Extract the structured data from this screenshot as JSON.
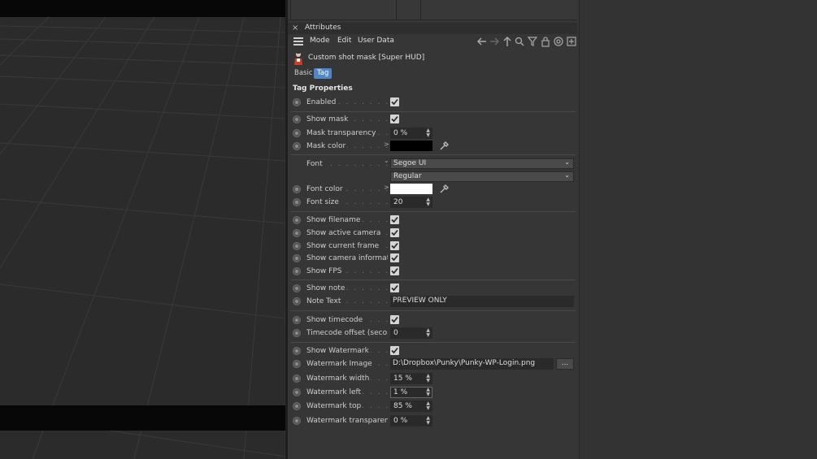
{
  "panel": {
    "title": "Attributes",
    "close_glyph": "×",
    "menu": [
      "Mode",
      "Edit",
      "User Data"
    ],
    "toolbar_icons": [
      "arrow-left-icon",
      "arrow-right-icon",
      "arrow-up-icon",
      "search-icon",
      "filter-icon",
      "lock-icon",
      "target-icon",
      "new-panel-icon"
    ]
  },
  "object": {
    "name": "Custom shot mask [Super HUD]",
    "icon": "person-icon"
  },
  "tabs": [
    {
      "label": "Basic",
      "active": false
    },
    {
      "label": "Tag",
      "active": true
    }
  ],
  "section_title": "Tag Properties",
  "fields": {
    "enabled": {
      "label": "Enabled",
      "checked": true
    },
    "show_mask": {
      "label": "Show mask",
      "checked": true
    },
    "mask_transparency": {
      "label": "Mask transparency",
      "value": "0 %"
    },
    "mask_color": {
      "label": "Mask color",
      "color": "#000000"
    },
    "font": {
      "label": "Font",
      "family": "Segoe UI",
      "style": "Regular"
    },
    "font_color": {
      "label": "Font color",
      "color": "#ffffff"
    },
    "font_size": {
      "label": "Font size",
      "value": "20"
    },
    "show_filename": {
      "label": "Show filename",
      "checked": true
    },
    "show_active_camera": {
      "label": "Show active camera",
      "checked": true
    },
    "show_current_frame": {
      "label": "Show current frame",
      "checked": true
    },
    "show_camera_information": {
      "label": "Show camera information",
      "checked": true
    },
    "show_fps": {
      "label": "Show FPS",
      "checked": true
    },
    "show_note": {
      "label": "Show note",
      "checked": true
    },
    "note_text": {
      "label": "Note Text",
      "value": "PREVIEW ONLY"
    },
    "show_timecode": {
      "label": "Show timecode",
      "checked": true
    },
    "timecode_offset": {
      "label": "Timecode offset (seconds)",
      "value": "0"
    },
    "show_watermark": {
      "label": "Show Watermark",
      "checked": true
    },
    "watermark_image": {
      "label": "Watermark Image",
      "value": "D:\\Dropbox\\Punky\\Punky-WP-Login.png",
      "browse_label": "..."
    },
    "watermark_width": {
      "label": "Watermark width",
      "value": "15 %"
    },
    "watermark_left": {
      "label": "Watermark left",
      "value": "1 %"
    },
    "watermark_top": {
      "label": "Watermark top",
      "value": "85 %"
    },
    "watermark_transparency": {
      "label": "Watermark transparency",
      "value": "0 %"
    }
  },
  "colors": {
    "tab_active": "#4f87c8",
    "panel_bg": "#363636",
    "viewport_bg": "#2b2b2b"
  }
}
